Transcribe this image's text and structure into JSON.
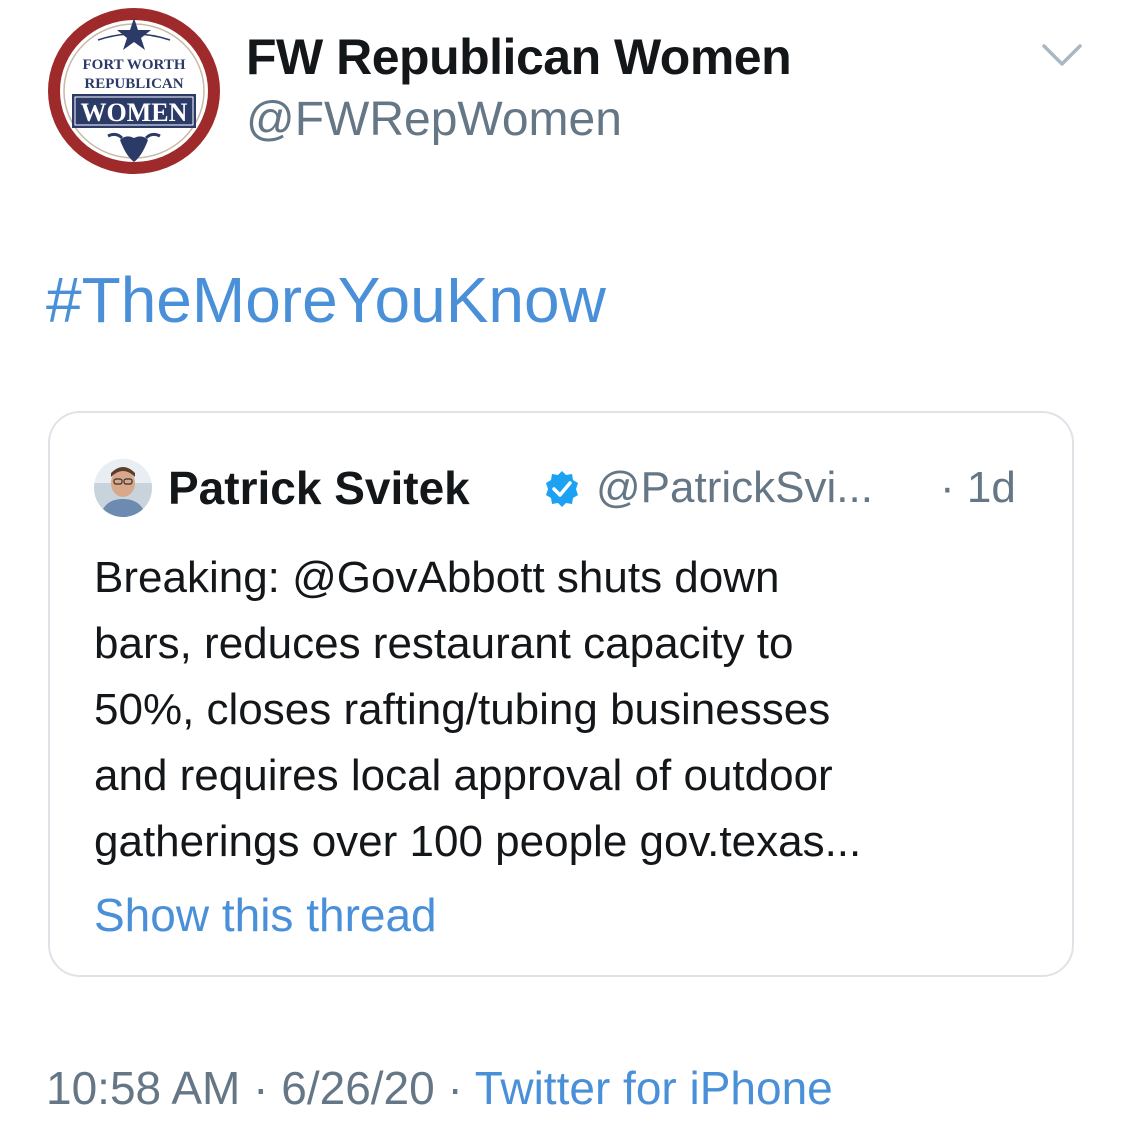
{
  "tweet": {
    "author": {
      "display_name": "FW Republican Women",
      "handle": "@FWRepWomen",
      "avatar_icon": "fort-worth-republican-women-logo",
      "logo_text": {
        "line1": "FORT WORTH",
        "line2": "REPUBLICAN",
        "line3": "WOMEN"
      }
    },
    "menu_icon": "chevron-down-icon",
    "hashtag": "#TheMoreYouKnow",
    "quoted": {
      "display_name": "Patrick Svitek",
      "verified": true,
      "handle": "@PatrickSvi...",
      "time": "· 1d",
      "text_lines": [
        "Breaking: @GovAbbott shuts down",
        "bars, reduces restaurant capacity to",
        "50%, closes rafting/tubing businesses",
        "and requires local approval of outdoor",
        "gatherings over 100 people gov.texas..."
      ],
      "show_thread": "Show this thread"
    },
    "meta": {
      "time": "10:58 AM",
      "sep1": " · ",
      "date": "6/26/20",
      "sep2": " · ",
      "source": "Twitter for iPhone"
    }
  },
  "colors": {
    "link": "#4a90d9",
    "secondary_text": "#657786",
    "primary_text": "#14171a",
    "card_border": "#dfe3e8",
    "logo_ring": "#9e2a2b",
    "logo_navy": "#2b3a67"
  }
}
